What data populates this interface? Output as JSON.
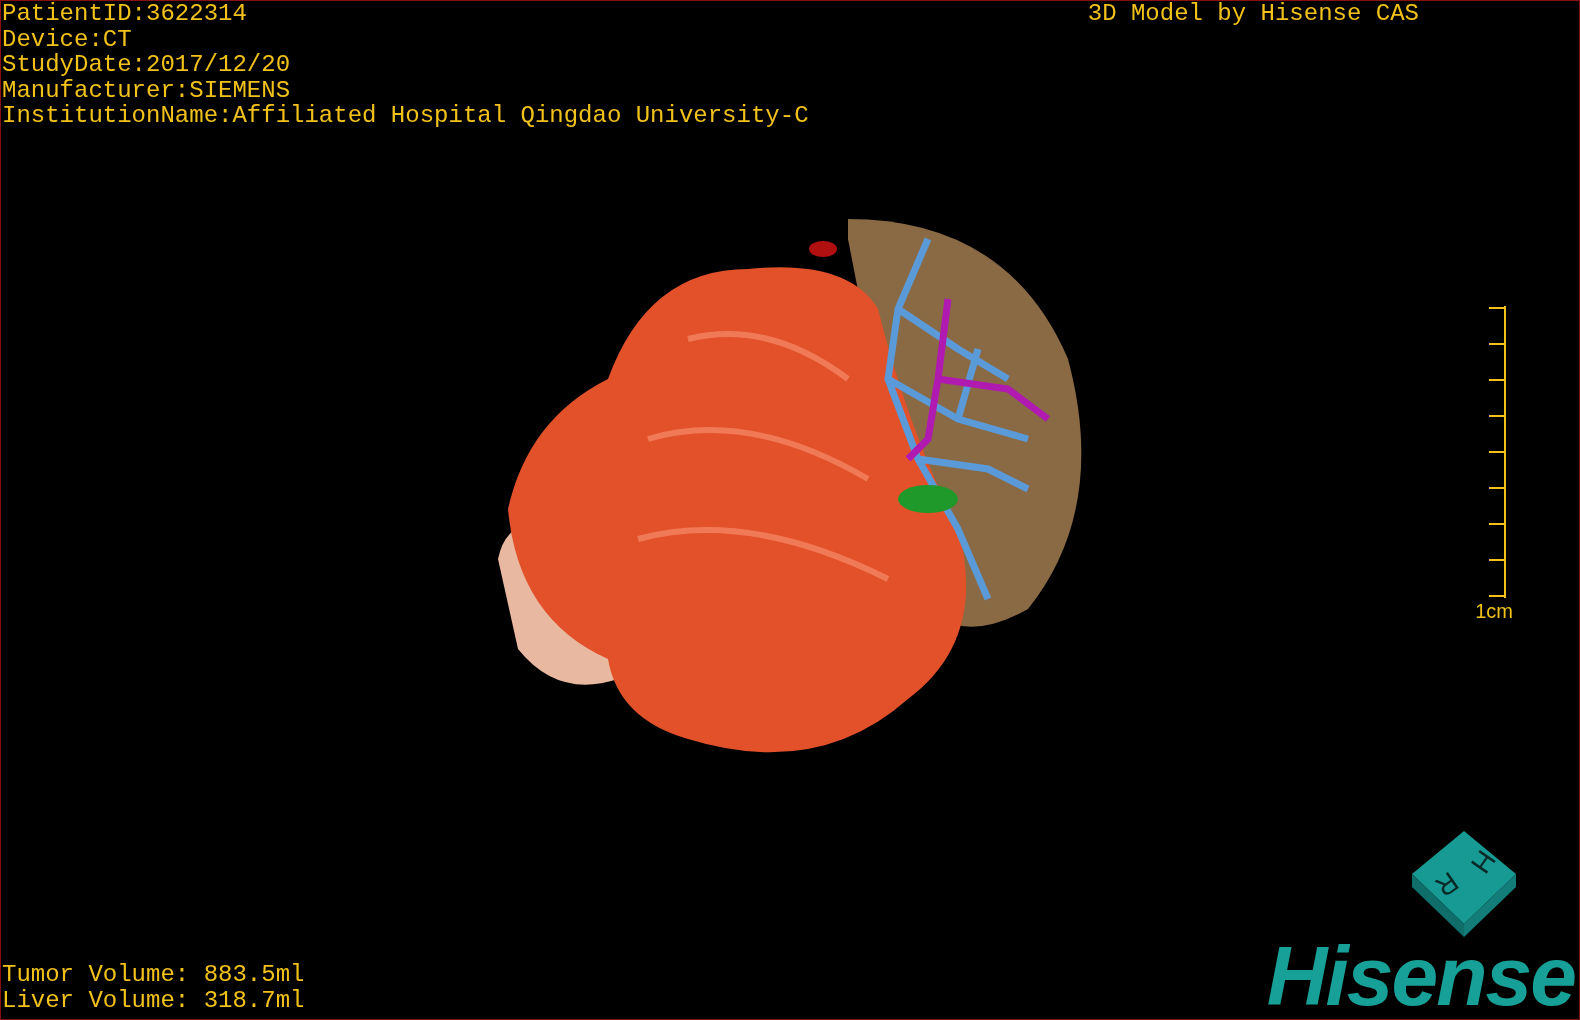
{
  "info": [
    "PatientID:3622314",
    "Device:CT",
    "StudyDate:2017/12/20",
    "Manufacturer:SIEMENS",
    "InstitutionName:Affiliated Hospital Qingdao University-C"
  ],
  "title": "3D Model by Hisense CAS",
  "scale": {
    "label": "1cm"
  },
  "volumes": [
    "Tumor Volume: 883.5ml",
    "Liver Volume: 318.7ml"
  ],
  "orientation_cube": {
    "faces": [
      "H",
      "R"
    ]
  },
  "logo": "Hisense"
}
